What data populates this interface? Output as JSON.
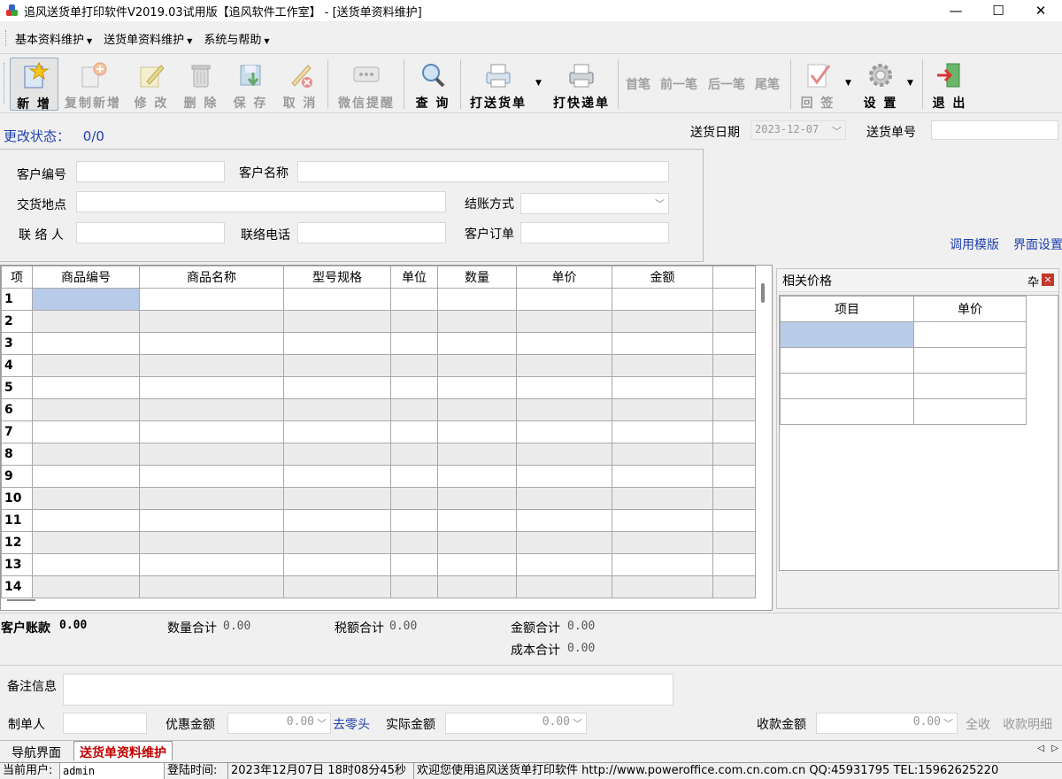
{
  "window": {
    "title": "追风送货单打印软件V2019.03试用版【追风软件工作室】 - [送货单资料维护]",
    "minimize": "—",
    "maximize": "☐",
    "close": "✕"
  },
  "menu": [
    "基本资料维护",
    "送货单资料维护",
    "系统与帮助"
  ],
  "toolbar": {
    "new": "新 增",
    "copy_new": "复制新增",
    "edit": "修 改",
    "delete": "删 除",
    "save": "保 存",
    "cancel": "取 消",
    "wechat": "微信提醒",
    "query": "查 询",
    "print_delivery": "打送货单",
    "print_express": "打快递单",
    "first": "首笔",
    "prev": "前一笔",
    "next": "后一笔",
    "last": "尾笔",
    "sign": "回 签",
    "settings": "设 置",
    "exit": "退 出"
  },
  "status": {
    "label": "更改状态：",
    "value": "0/0"
  },
  "header": {
    "date_label": "送货日期",
    "date_value": "2023-12-07",
    "order_no_label": "送货单号",
    "order_no_value": ""
  },
  "form": {
    "customer_code_label": "客户编号",
    "customer_name_label": "客户名称",
    "delivery_place_label": "交货地点",
    "settlement_label": "结账方式",
    "contact_label": "联 络 人",
    "phone_label": "联络电话",
    "customer_order_label": "客户订单"
  },
  "links": {
    "template": "调用模版",
    "ui_settings": "界面设置"
  },
  "grid": {
    "columns": [
      "项",
      "商品编号",
      "商品名称",
      "型号规格",
      "单位",
      "数量",
      "单价",
      "金额"
    ],
    "rows": [
      "1",
      "2",
      "3",
      "4",
      "5",
      "6",
      "7",
      "8",
      "9",
      "10",
      "11",
      "12",
      "13",
      "14"
    ]
  },
  "side": {
    "title": "相关价格",
    "pin": "卆",
    "close": "×",
    "columns": [
      "项目",
      "单价"
    ]
  },
  "totals": {
    "customer_debt_label": "客户账款",
    "customer_debt": "0.00",
    "qty_label": "数量合计",
    "qty": "0.00",
    "tax_label": "税额合计",
    "tax": "0.00",
    "amount_label": "金额合计",
    "amount": "0.00",
    "cost_label": "成本合计",
    "cost": "0.00"
  },
  "footer": {
    "remark_label": "备注信息",
    "maker_label": "制单人",
    "discount_label": "优惠金额",
    "discount": "0.00",
    "round_link": "去零头",
    "actual_label": "实际金额",
    "actual": "0.00",
    "receive_label": "收款金额",
    "receive": "0.00",
    "all_receive": "全收",
    "receive_detail": "收款明细"
  },
  "tabs": [
    "导航界面",
    "送货单资料维护"
  ],
  "statusbar": {
    "user_label": "当前用户:",
    "user": "admin",
    "login_label": "登陆时间:",
    "login_time": "2023年12月07日 18时08分45秒",
    "welcome": "欢迎您使用追风送货单打印软件 http://www.poweroffice.com.cn.com.cn QQ:45931795 TEL:15962625220"
  },
  "colors": {
    "accent_link": "#1f3fb0",
    "selected_cell": "#b8cbe8",
    "active_tab": "#c00000"
  }
}
